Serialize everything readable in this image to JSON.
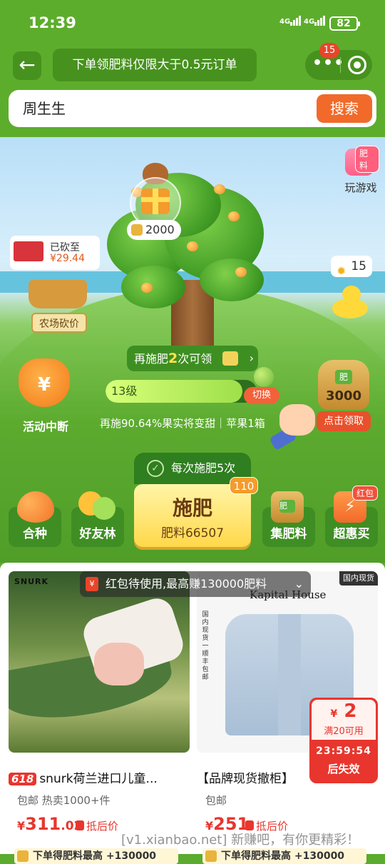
{
  "status": {
    "time": "12:39",
    "sim1": "4G",
    "sim2": "4G",
    "battery": "82"
  },
  "header": {
    "back_icon": "back-arrow-icon",
    "banner": "下单领肥料仅限大于0.5元订单",
    "message_count": "15"
  },
  "search": {
    "value": "周生生",
    "button": "搜索"
  },
  "scene": {
    "gift_coins": "2000",
    "game": {
      "badge": "肥料",
      "label": "玩游戏"
    },
    "bargain": {
      "line1": "已砍至",
      "line2": "¥29.44",
      "label": "农场砍价"
    },
    "duck_count": "15",
    "fert_tip": {
      "prefix": "再施肥",
      "count": "2",
      "suffix": "次可领"
    },
    "level": {
      "label": "13级",
      "progress": 0.9064
    },
    "switch": "切换",
    "activity": {
      "label": "活动中断",
      "icon_text": "¥"
    },
    "progress_text": "再施90.64%果实将变甜｜苹果1箱",
    "bag": {
      "badge": "肥",
      "amount": "3000",
      "claim": "点击领取"
    },
    "fertilize": {
      "each": "每次施肥5次",
      "main": "施肥",
      "sub": "肥料66507",
      "badge": "110"
    }
  },
  "nav": {
    "plant": "合种",
    "forest": "好友林",
    "collect": "集肥料",
    "collect_badge": "肥",
    "super": "超惠买",
    "super_badge": "红包"
  },
  "feed": {
    "banner": "红包待使用,最高赚130000肥料",
    "banner_icon": "¥",
    "coupon": {
      "amount": "2",
      "currency": "¥",
      "condition": "满20可用",
      "timer": "23:59:54",
      "expire": "后失效"
    },
    "items": [
      {
        "brand": "SNURK",
        "tag": "618",
        "title": "snurk荷兰进口儿童...",
        "sub": "包邮 热卖1000+件",
        "price_currency": "¥",
        "price_int": "311",
        "price_dec": ".02",
        "deduct": "抵后价",
        "strip": "下单得肥料最高 +130000"
      },
      {
        "brand": "Kapital House",
        "stock_tag": "国内现货",
        "sf_badge": "国内现货 一顺丰包邮",
        "title": "【品牌现货撤柜】",
        "sub": "包邮",
        "price_currency": "¥",
        "price_int": "251",
        "price_dec": "",
        "deduct": "抵后价",
        "strip": "下单得肥料最高 +130000"
      }
    ]
  },
  "watermark": "[v1.xianbao.net] 新赚吧，有你更精彩！",
  "colors": {
    "primary_green": "#5dad2c",
    "accent_orange": "#f26a2a",
    "price_red": "#e8362e"
  }
}
